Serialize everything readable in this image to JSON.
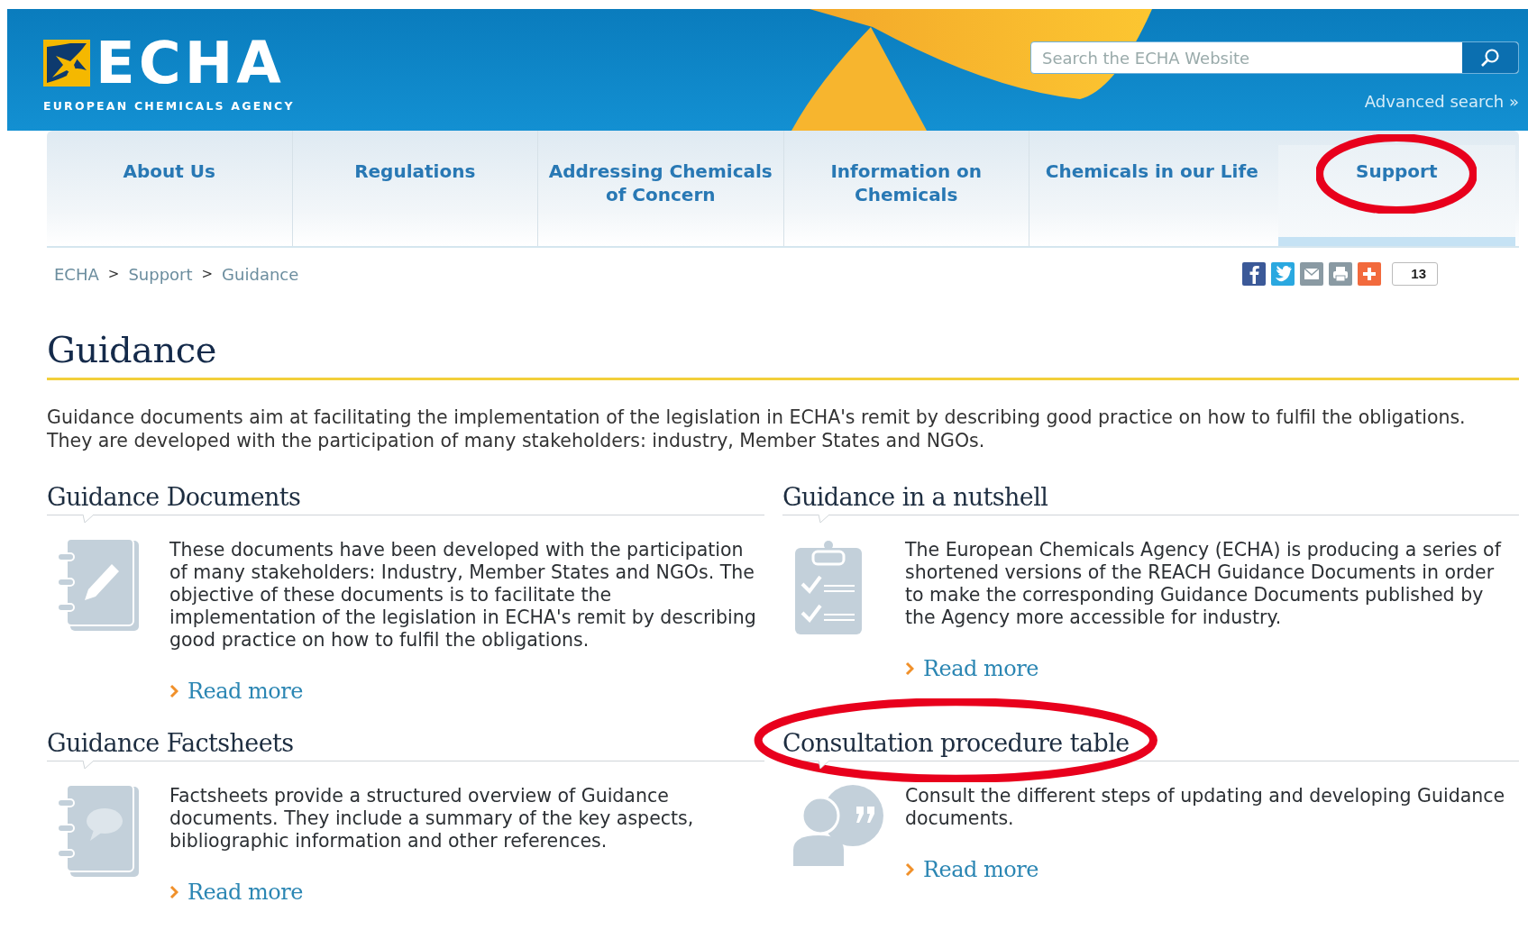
{
  "header": {
    "logo": {
      "wordmark": "ECHA",
      "tagline": "EUROPEAN CHEMICALS AGENCY"
    },
    "search": {
      "placeholder": "Search the ECHA Website"
    },
    "advanced_search": "Advanced search »"
  },
  "nav": [
    {
      "label": "About Us",
      "selected": false,
      "circled": false
    },
    {
      "label": "Regulations",
      "selected": false,
      "circled": false
    },
    {
      "label": "Addressing Chemicals of Concern",
      "selected": false,
      "circled": false
    },
    {
      "label": "Information on Chemicals",
      "selected": false,
      "circled": false
    },
    {
      "label": "Chemicals in our Life",
      "selected": false,
      "circled": false
    },
    {
      "label": "Support",
      "selected": true,
      "circled": true
    }
  ],
  "breadcrumb": {
    "items": [
      "ECHA",
      "Support",
      "Guidance"
    ],
    "separator": ">"
  },
  "share": {
    "buttons": [
      {
        "kind": "facebook"
      },
      {
        "kind": "twitter"
      },
      {
        "kind": "email"
      },
      {
        "kind": "print"
      },
      {
        "kind": "more"
      }
    ],
    "count": "13"
  },
  "page": {
    "title": "Guidance",
    "intro": "Guidance documents aim at facilitating the implementation of the legislation in ECHA's remit by describing good practice on how to fulfil the obligations. They are developed with the participation of many stakeholders: industry, Member States and NGOs."
  },
  "sections": [
    {
      "title": "Guidance Documents",
      "kind": "notebook-pencil",
      "text": "These documents have been developed with the participation of many stakeholders: Industry, Member States and NGOs. The objective of these documents is to facilitate the implementation of the legislation in ECHA's remit by describing good practice on how to fulfil the obligations.",
      "link": "Read more",
      "circled": false
    },
    {
      "title": "Guidance in a nutshell",
      "kind": "clipboard",
      "text": "The European Chemicals Agency (ECHA) is producing a series of shortened versions of the REACH Guidance Documents in order to make the corresponding Guidance Documents published by the Agency more accessible for industry.",
      "link": "Read more",
      "circled": false
    },
    {
      "title": "Guidance Factsheets",
      "kind": "notebook-speech",
      "text": "Factsheets provide a structured overview of Guidance documents. They include a summary of the key aspects, bibliographic information and other references.",
      "link": "Read more",
      "circled": false
    },
    {
      "title": "Consultation procedure table",
      "kind": "person-quote",
      "text": "Consult the different steps of updating and developing Guidance documents.",
      "link": "Read more",
      "circled": true
    }
  ]
}
